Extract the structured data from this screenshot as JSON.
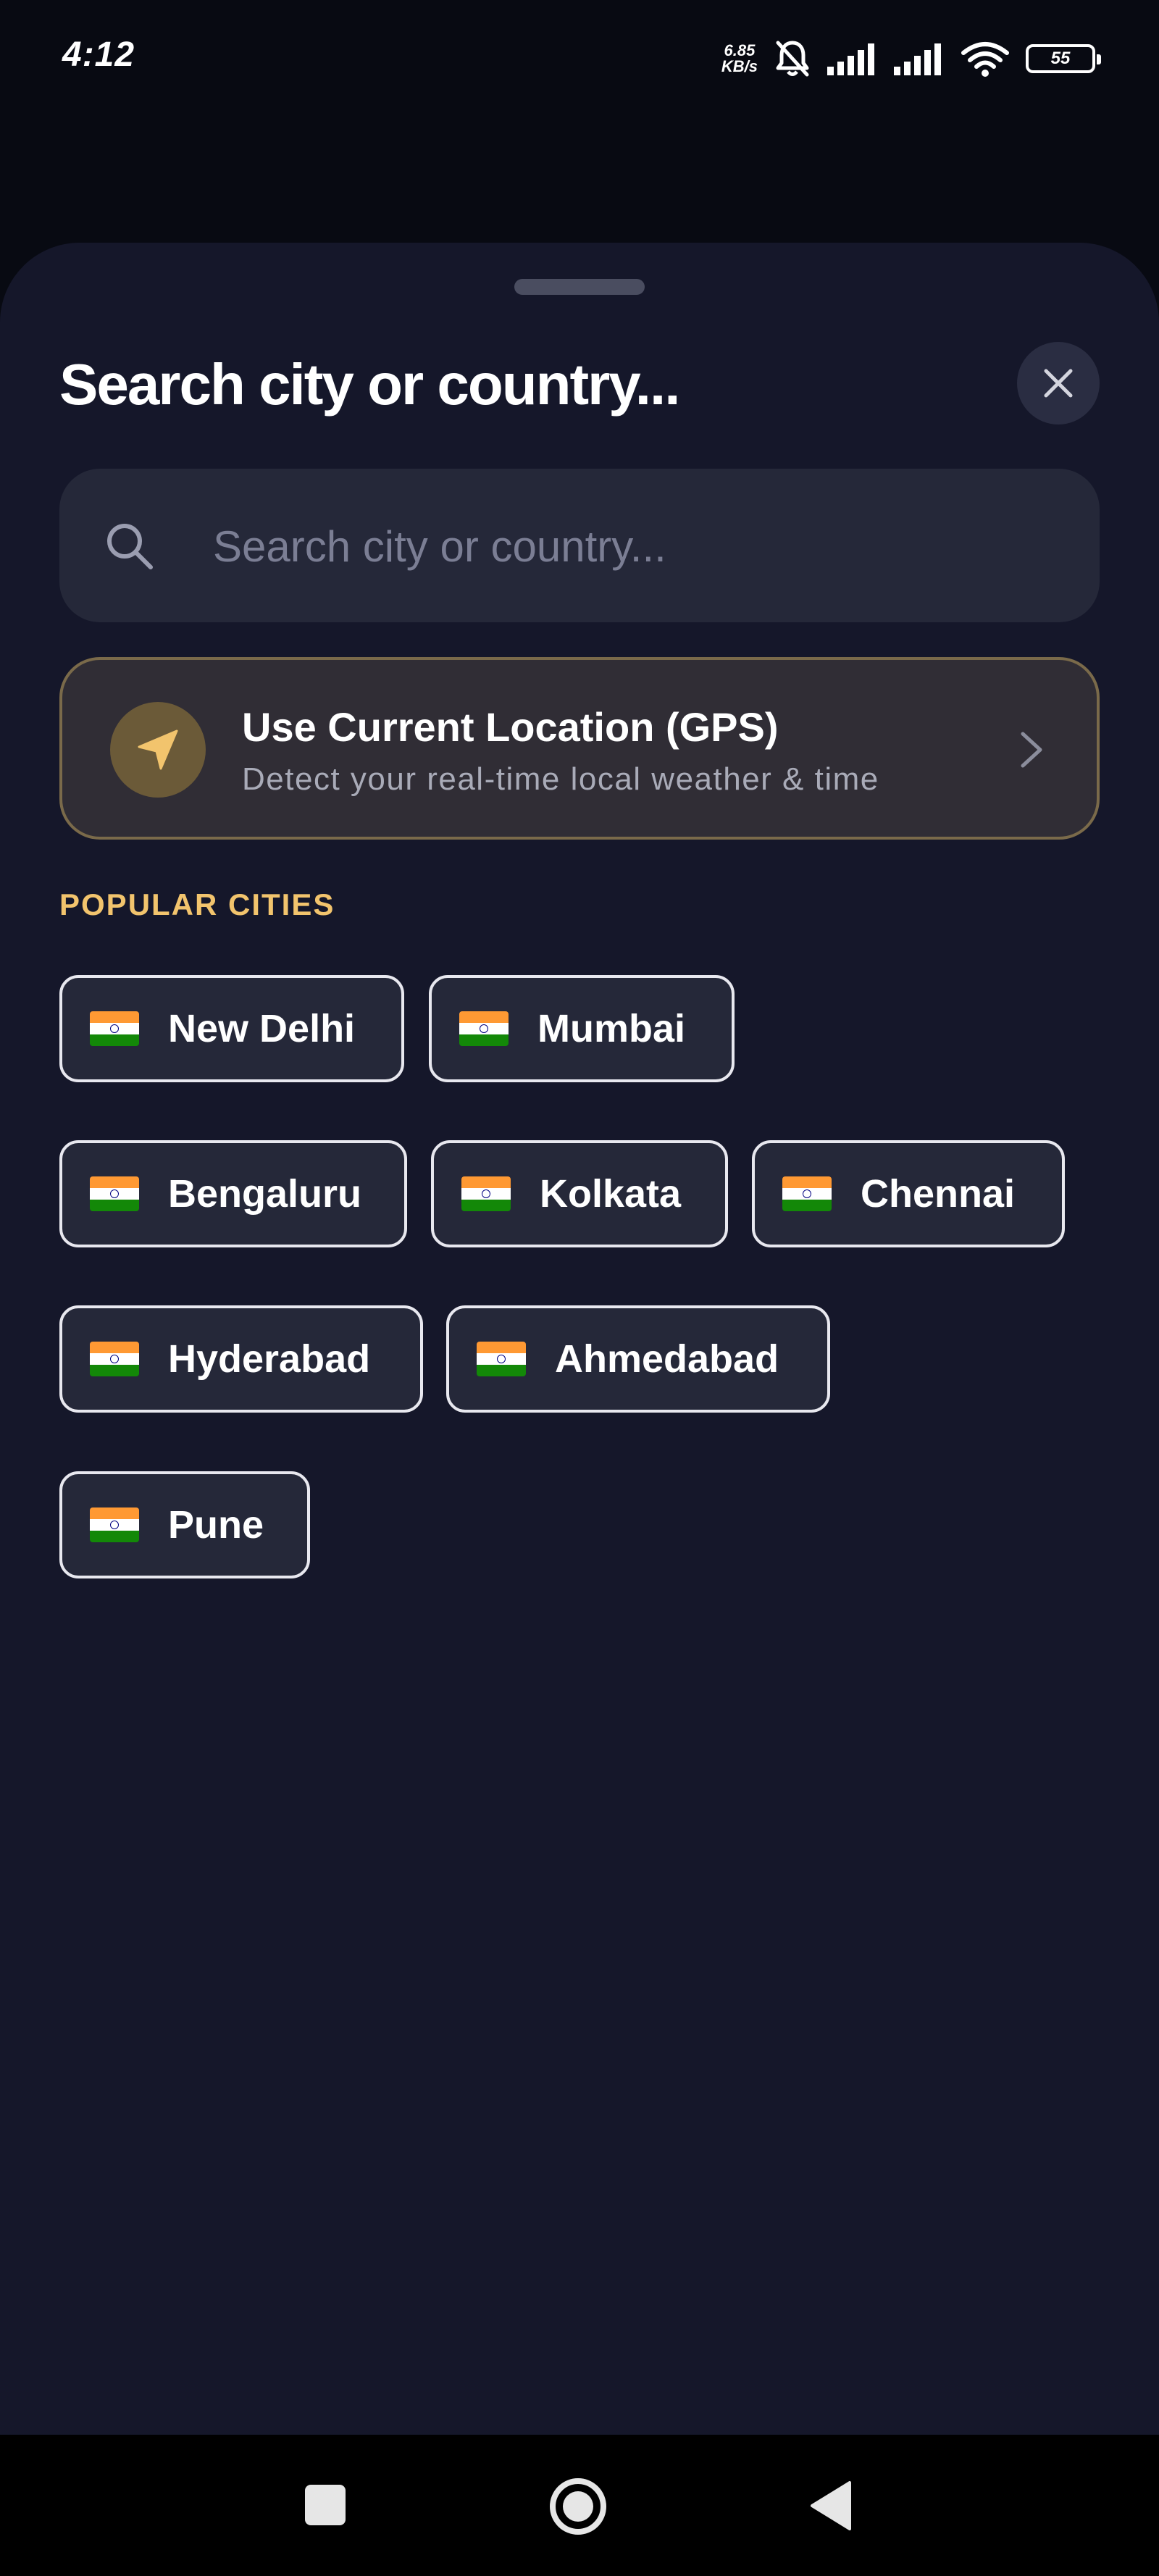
{
  "status_bar": {
    "time": "4:12",
    "net_speed_value": "6.85",
    "net_speed_unit": "KB/s",
    "battery_level": "55"
  },
  "sheet": {
    "title": "Search city or country...",
    "close_icon": "close-icon"
  },
  "search": {
    "placeholder": "Search city or country...",
    "value": ""
  },
  "gps": {
    "title": "Use Current Location (GPS)",
    "subtitle": "Detect your real-time local weather & time",
    "icon": "navigation-arrow-icon"
  },
  "popular": {
    "heading": "POPULAR CITIES",
    "cities": [
      {
        "label": "New Delhi",
        "flag": "india-flag"
      },
      {
        "label": "Mumbai",
        "flag": "india-flag"
      },
      {
        "label": "Bengaluru",
        "flag": "india-flag"
      },
      {
        "label": "Kolkata",
        "flag": "india-flag"
      },
      {
        "label": "Chennai",
        "flag": "india-flag"
      },
      {
        "label": "Hyderabad",
        "flag": "india-flag"
      },
      {
        "label": "Ahmedabad",
        "flag": "india-flag"
      },
      {
        "label": "Pune",
        "flag": "india-flag"
      }
    ]
  },
  "colors": {
    "background": "#15172a",
    "accent": "#f2c46d",
    "chip_border": "#e8e8ef"
  }
}
